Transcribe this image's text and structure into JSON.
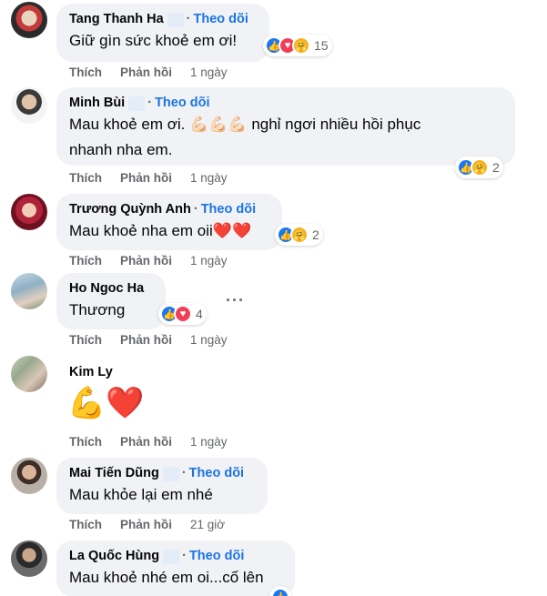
{
  "colors": {
    "bubble": "#f0f2f5",
    "follow": "#1b74e4",
    "meta": "#65676b",
    "like": "#1877f2",
    "love": "#f33e58",
    "care": "#f7b125"
  },
  "actions": {
    "like": "Thích",
    "reply": "Phản hồi",
    "dot": "·",
    "follow": "Theo dõi"
  },
  "comments": [
    {
      "name": "Tang Thanh Ha",
      "text": "Giữ gìn sức khoẻ em ơi!",
      "reactions": [
        "like",
        "love",
        "care"
      ],
      "reaction_count": "15",
      "time": "1 ngày"
    },
    {
      "name": "Minh Bùi",
      "text_line1": "Mau khoẻ em ơi. 💪🏻💪🏻💪🏻 nghỉ ngơi nhiều hồi phục",
      "text_line2": "nhanh nha em.",
      "reactions": [
        "like",
        "care"
      ],
      "reaction_count": "2",
      "time": "1 ngày"
    },
    {
      "name": "Trương Quỳnh Anh",
      "text": "Mau khoẻ nha em oii❤️❤️",
      "reactions": [
        "like",
        "care"
      ],
      "reaction_count": "2",
      "time": "1 ngày"
    },
    {
      "name": "Ho Ngoc Ha",
      "text": "Thương",
      "reactions": [
        "like",
        "love"
      ],
      "reaction_count": "4",
      "time": "1 ngày",
      "more": "···"
    },
    {
      "name": "Kim Ly",
      "text": "💪❤️",
      "time": "1 ngày"
    },
    {
      "name": "Mai Tiến Dũng",
      "text": "Mau khỏe lại em nhé",
      "time": "21 giờ"
    },
    {
      "name": "La Quốc Hùng",
      "text": "Mau khoẻ nhé em oi...cố lên"
    }
  ]
}
